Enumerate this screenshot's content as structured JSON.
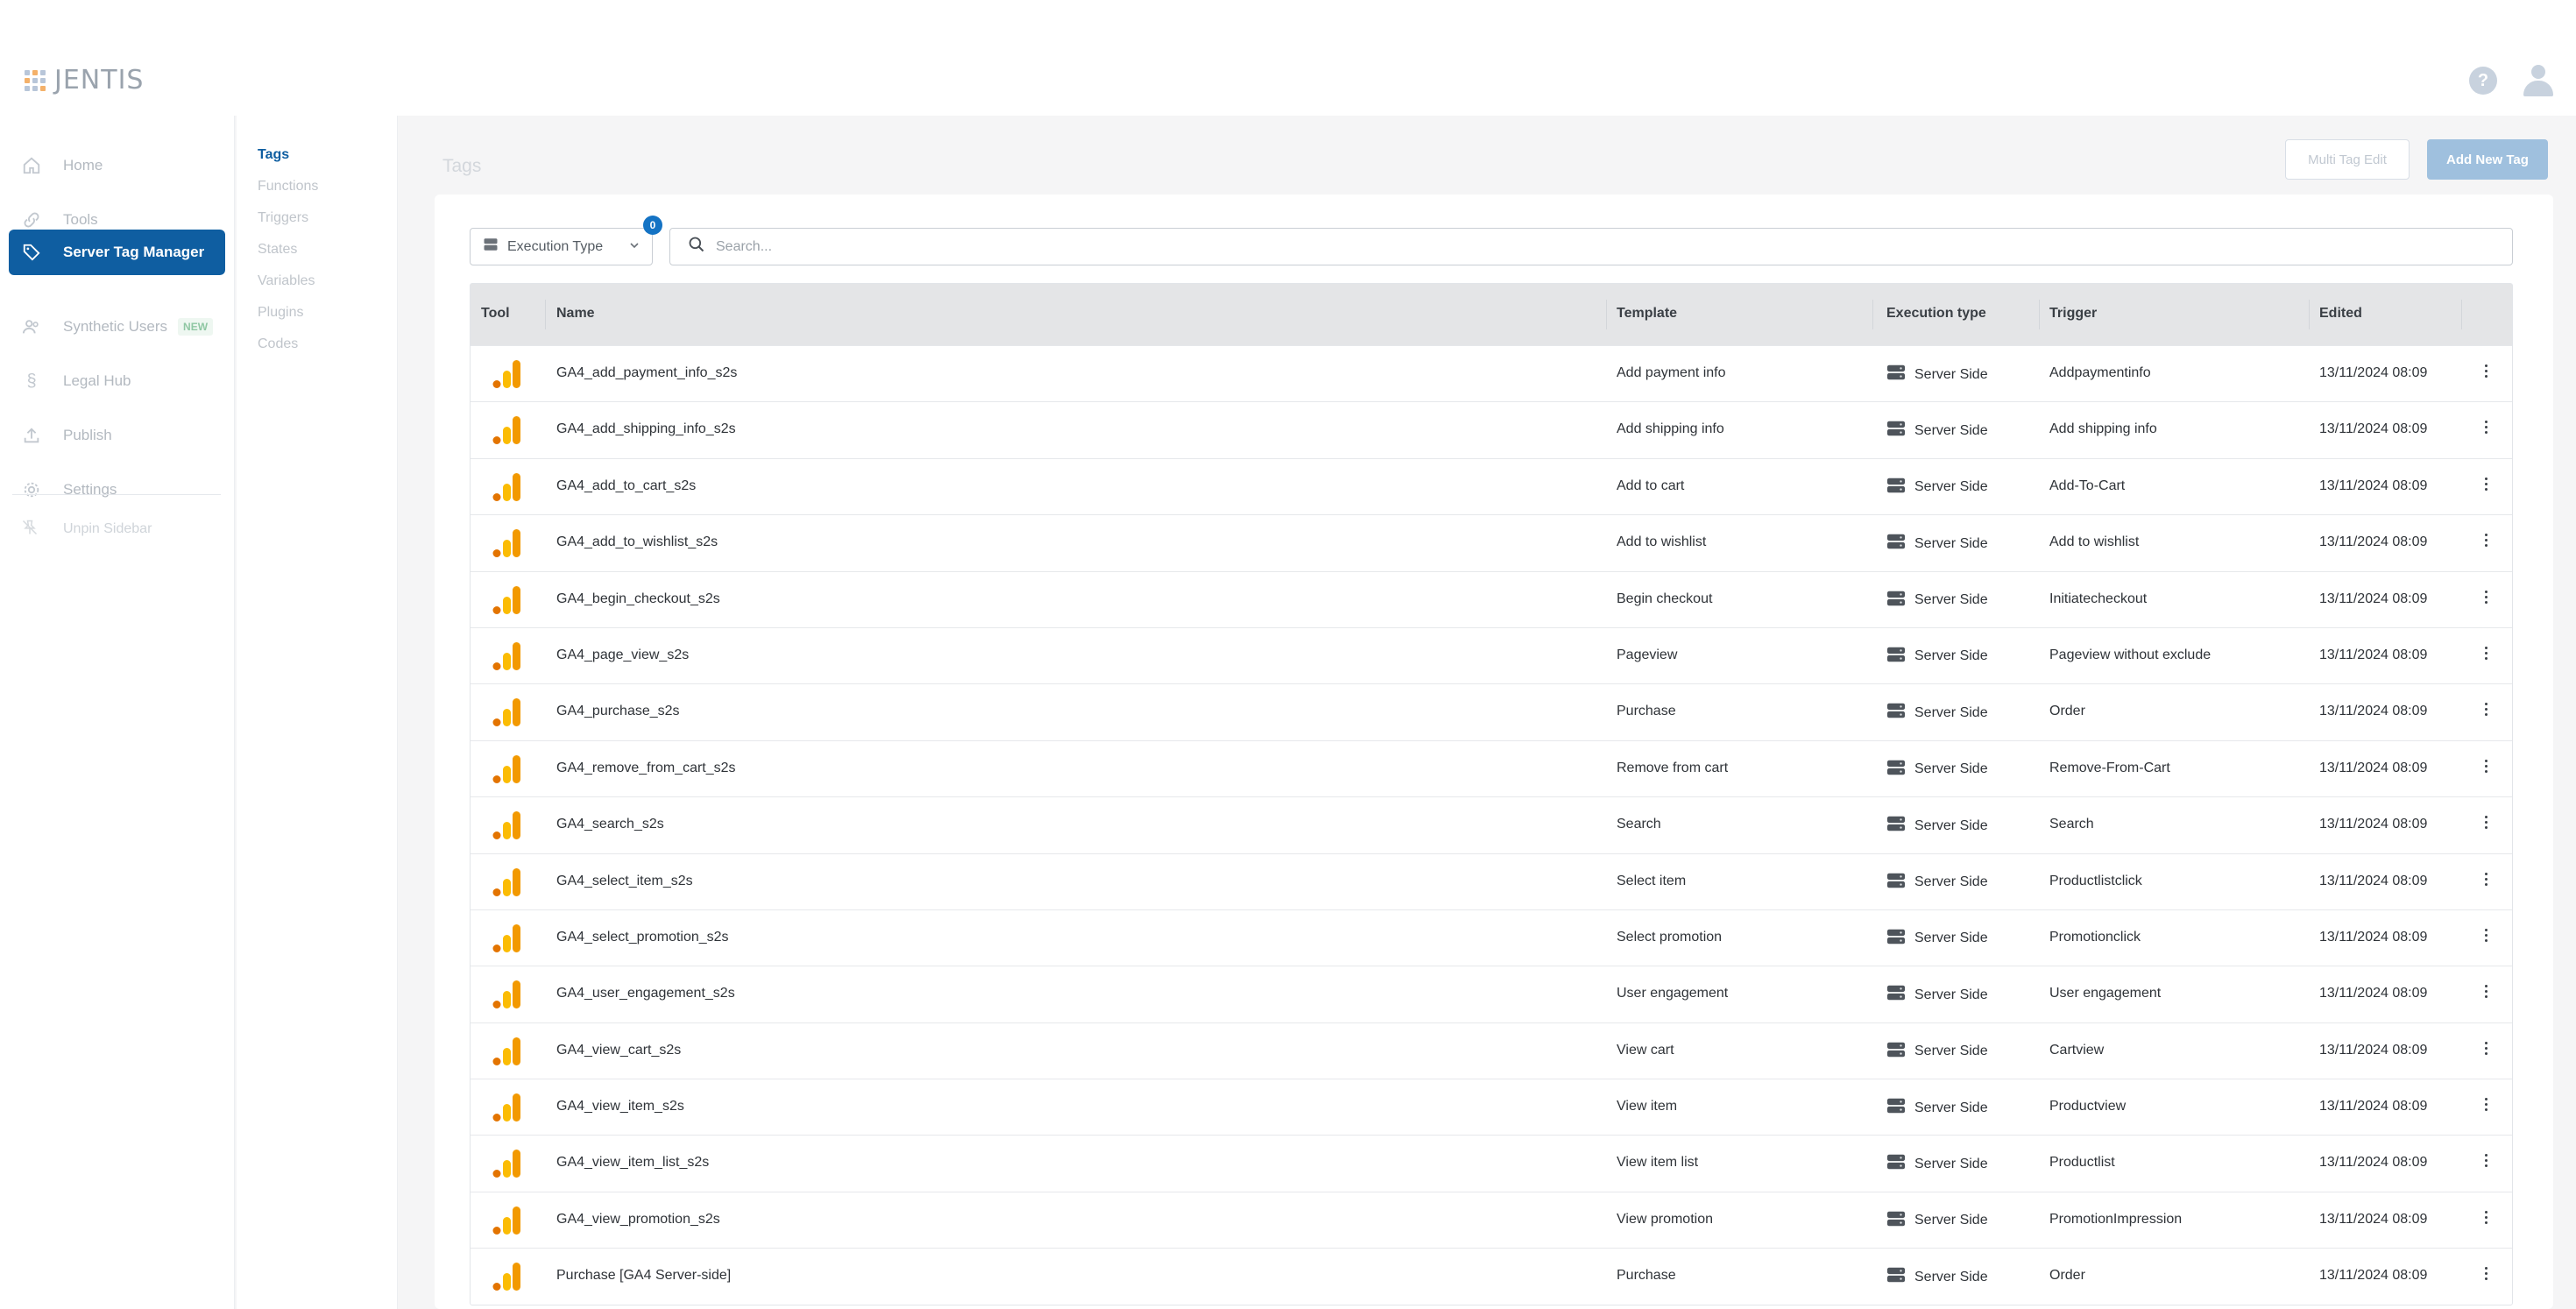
{
  "brand": {
    "name": "JENTIS"
  },
  "colors": {
    "accent": "#0f5ea1",
    "badge": "#1473c4",
    "ga_orange": "#f29900",
    "ga_yellow": "#fbbc04"
  },
  "sidebar": {
    "items": [
      {
        "label": "Home",
        "icon": "home-icon"
      },
      {
        "label": "Tools",
        "icon": "link-icon"
      },
      {
        "label": "Server Tag Manager",
        "icon": "tag-icon",
        "active": true
      },
      {
        "label": "Synthetic Users",
        "icon": "users-icon",
        "badge": "NEW"
      },
      {
        "label": "Legal Hub",
        "icon": "section-icon"
      },
      {
        "label": "Publish",
        "icon": "upload-icon"
      },
      {
        "label": "Settings",
        "icon": "gear-icon"
      }
    ],
    "unpin_label": "Unpin Sidebar"
  },
  "submenu": {
    "items": [
      "Tags",
      "Functions",
      "Triggers",
      "States",
      "Variables",
      "Plugins",
      "Codes"
    ],
    "active": "Tags"
  },
  "page": {
    "title": "Tags",
    "multi_edit_label": "Multi Tag Edit",
    "add_label": "Add New Tag"
  },
  "filters": {
    "execution_type_label": "Execution Type",
    "execution_type_count": "0",
    "search_placeholder": "Search..."
  },
  "table": {
    "columns": [
      "Tool",
      "Name",
      "Template",
      "Execution type",
      "Trigger",
      "Edited"
    ],
    "rows": [
      {
        "name": "GA4_add_payment_info_s2s",
        "template": "Add payment info",
        "exec": "Server Side",
        "trigger": "Addpaymentinfo",
        "edited": "13/11/2024 08:09"
      },
      {
        "name": "GA4_add_shipping_info_s2s",
        "template": "Add shipping info",
        "exec": "Server Side",
        "trigger": "Add shipping info",
        "edited": "13/11/2024 08:09"
      },
      {
        "name": "GA4_add_to_cart_s2s",
        "template": "Add to cart",
        "exec": "Server Side",
        "trigger": "Add-To-Cart",
        "edited": "13/11/2024 08:09"
      },
      {
        "name": "GA4_add_to_wishlist_s2s",
        "template": "Add to wishlist",
        "exec": "Server Side",
        "trigger": "Add to wishlist",
        "edited": "13/11/2024 08:09"
      },
      {
        "name": "GA4_begin_checkout_s2s",
        "template": "Begin checkout",
        "exec": "Server Side",
        "trigger": "Initiatecheckout",
        "edited": "13/11/2024 08:09"
      },
      {
        "name": "GA4_page_view_s2s",
        "template": "Pageview",
        "exec": "Server Side",
        "trigger": "Pageview without exclude",
        "edited": "13/11/2024 08:09"
      },
      {
        "name": "GA4_purchase_s2s",
        "template": "Purchase",
        "exec": "Server Side",
        "trigger": "Order",
        "edited": "13/11/2024 08:09"
      },
      {
        "name": "GA4_remove_from_cart_s2s",
        "template": "Remove from cart",
        "exec": "Server Side",
        "trigger": "Remove-From-Cart",
        "edited": "13/11/2024 08:09"
      },
      {
        "name": "GA4_search_s2s",
        "template": "Search",
        "exec": "Server Side",
        "trigger": "Search",
        "edited": "13/11/2024 08:09"
      },
      {
        "name": "GA4_select_item_s2s",
        "template": "Select item",
        "exec": "Server Side",
        "trigger": "Productlistclick",
        "edited": "13/11/2024 08:09"
      },
      {
        "name": "GA4_select_promotion_s2s",
        "template": "Select promotion",
        "exec": "Server Side",
        "trigger": "Promotionclick",
        "edited": "13/11/2024 08:09"
      },
      {
        "name": "GA4_user_engagement_s2s",
        "template": "User engagement",
        "exec": "Server Side",
        "trigger": "User engagement",
        "edited": "13/11/2024 08:09"
      },
      {
        "name": "GA4_view_cart_s2s",
        "template": "View cart",
        "exec": "Server Side",
        "trigger": "Cartview",
        "edited": "13/11/2024 08:09"
      },
      {
        "name": "GA4_view_item_s2s",
        "template": "View item",
        "exec": "Server Side",
        "trigger": "Productview",
        "edited": "13/11/2024 08:09"
      },
      {
        "name": "GA4_view_item_list_s2s",
        "template": "View item list",
        "exec": "Server Side",
        "trigger": "Productlist",
        "edited": "13/11/2024 08:09"
      },
      {
        "name": "GA4_view_promotion_s2s",
        "template": "View promotion",
        "exec": "Server Side",
        "trigger": "PromotionImpression",
        "edited": "13/11/2024 08:09"
      },
      {
        "name": "Purchase [GA4 Server-side]",
        "template": "Purchase",
        "exec": "Server Side",
        "trigger": "Order",
        "edited": "13/11/2024 08:09"
      }
    ]
  }
}
